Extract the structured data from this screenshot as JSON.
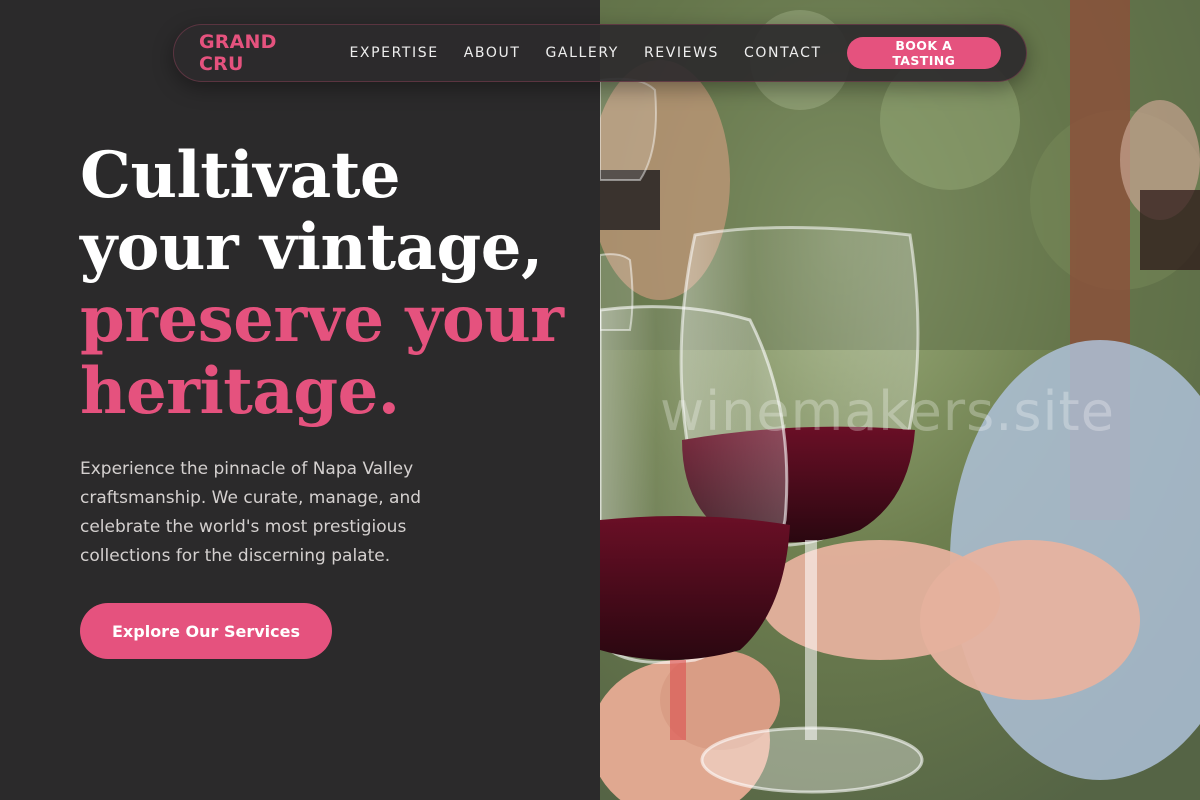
{
  "brand": {
    "logo": "GRAND CRU",
    "accent": "#e5527e"
  },
  "nav": {
    "links": [
      "EXPERTISE",
      "ABOUT",
      "GALLERY",
      "REVIEWS",
      "CONTACT"
    ],
    "cta": "BOOK A TASTING"
  },
  "hero": {
    "title_line1": "Cultivate",
    "title_line2": "your vintage,",
    "title_line3": "preserve your",
    "title_line4": "heritage.",
    "description": "Experience the pinnacle of Napa Valley craftsmanship. We curate, manage, and celebrate the world's most prestigious collections for the discerning palate.",
    "button": "Explore Our Services"
  },
  "photo": {
    "watermark": "winemakers.site"
  },
  "colors": {
    "background": "#2b2a2b",
    "accent": "#e5527e",
    "text_light": "#d4d0cf"
  }
}
